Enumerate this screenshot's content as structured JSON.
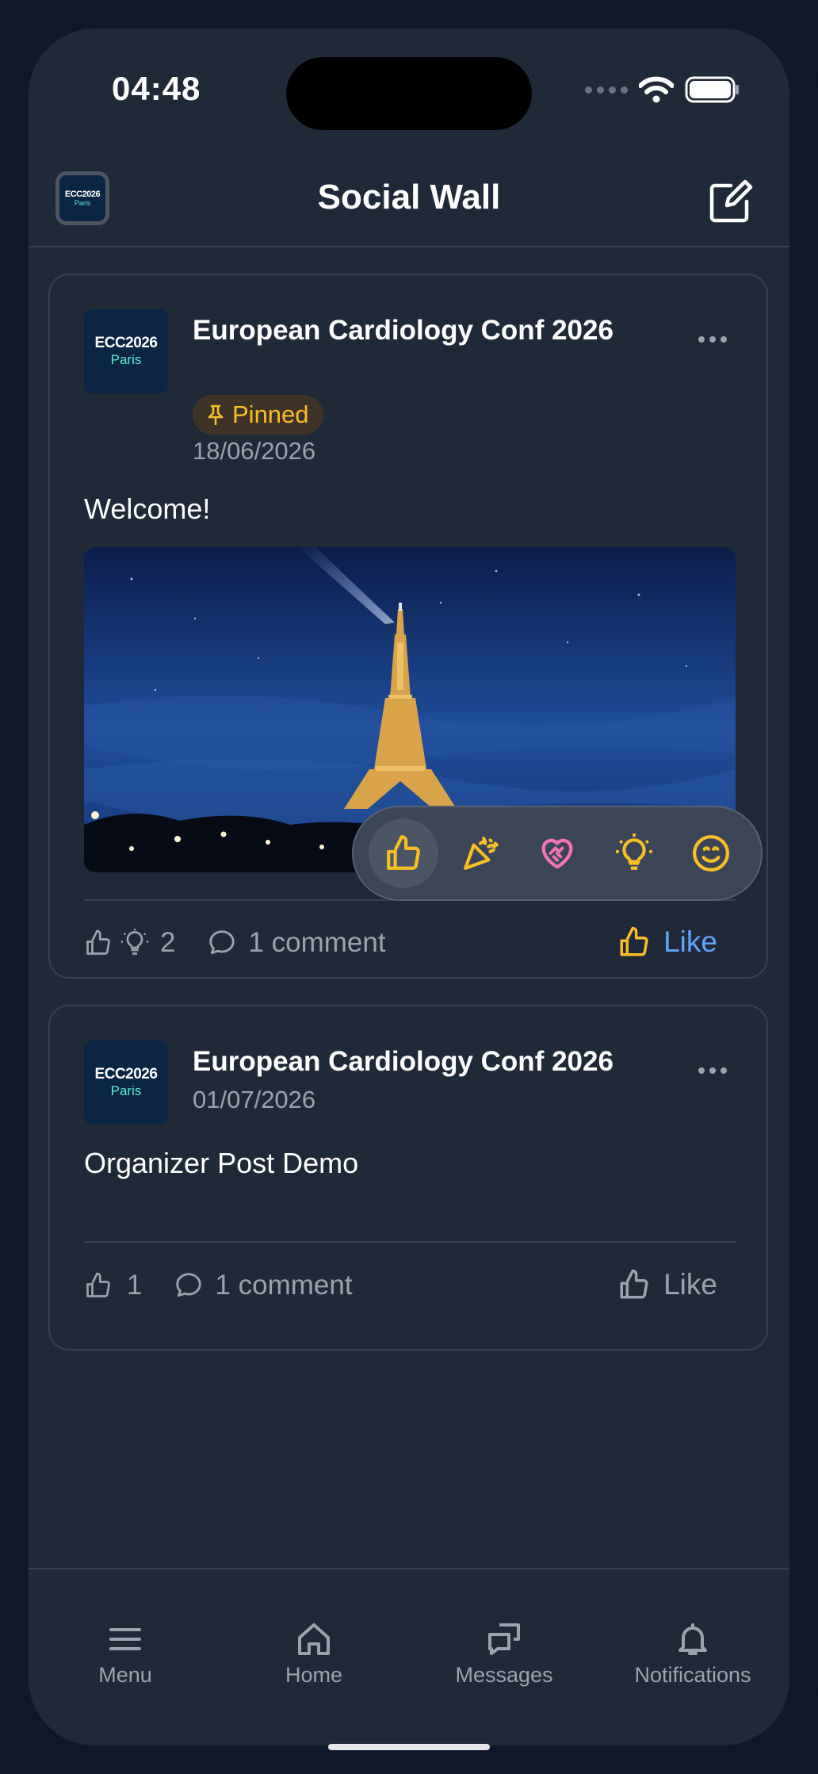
{
  "status_bar": {
    "time": "04:48"
  },
  "header": {
    "title": "Social Wall",
    "logo_line1": "ECC2026",
    "logo_line2": "Paris"
  },
  "posts": [
    {
      "author": "European Cardiology Conf 2026",
      "logo_line1": "ECC2026",
      "logo_line2": "Paris",
      "badge": "Pinned",
      "date": "18/06/2026",
      "text": "Welcome!",
      "image_icon": "eiffel-tower-night-photo",
      "reaction_count": "2",
      "comments": "1 comment",
      "like_label": "Like",
      "liked": true
    },
    {
      "author": "European Cardiology Conf 2026",
      "logo_line1": "ECC2026",
      "logo_line2": "Paris",
      "date": "01/07/2026",
      "text": "Organizer Post Demo",
      "reaction_count": "1",
      "comments": "1 comment",
      "like_label": "Like",
      "liked": false
    }
  ],
  "reaction_picker": [
    "thumbs-up-icon",
    "party-popper-icon",
    "heart-handshake-icon",
    "lightbulb-icon",
    "smile-icon"
  ],
  "tabbar": [
    {
      "label": "Menu",
      "icon": "menu-icon"
    },
    {
      "label": "Home",
      "icon": "home-icon"
    },
    {
      "label": "Messages",
      "icon": "messages-icon"
    },
    {
      "label": "Notifications",
      "icon": "bell-icon"
    }
  ],
  "colors": {
    "background": "#1f2937",
    "accent": "#60a5fa",
    "reaction_yellow": "#fbbf24",
    "reaction_pink": "#f472b6",
    "pinned_text": "#fbbf24"
  }
}
